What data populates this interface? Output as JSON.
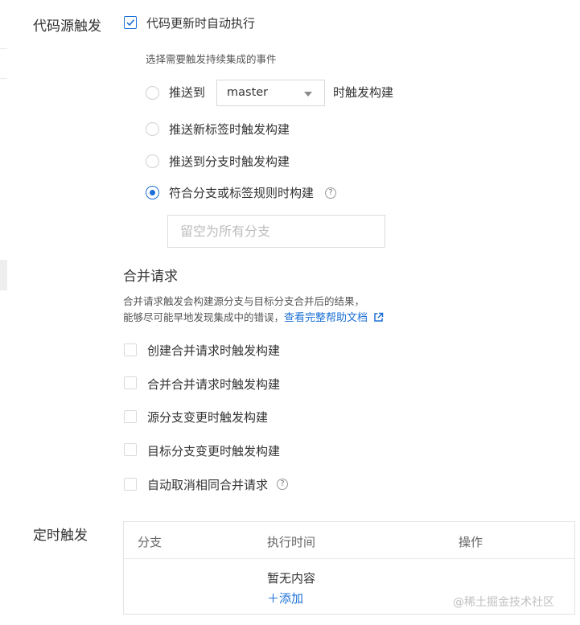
{
  "code_trigger": {
    "section_label": "代码源触发",
    "auto_run_label": "代码更新时自动执行",
    "auto_run_checked": true,
    "events_hint": "选择需要触发持续集成的事件",
    "push_to_label": "推送到",
    "branch_value": "master",
    "push_to_suffix": "时触发构建",
    "new_tag_label": "推送新标签时触发构建",
    "push_branch_label": "推送到分支时触发构建",
    "match_rule_label": "符合分支或标签规则时构建",
    "selected_option": "match_rule",
    "rule_placeholder": "留空为所有分支",
    "help_icon": "question-circle-icon",
    "checkbox_color": "#1b6fd6"
  },
  "merge_request": {
    "heading": "合并请求",
    "desc_line1": "合并请求触发会构建源分支与目标分支合并后的结果，",
    "desc_line2": "能够尽可能早地发现集成中的错误，",
    "help_link": "查看完整帮助文档",
    "link_icon": "external-link-icon",
    "options": [
      {
        "label": "创建合并请求时触发构建",
        "checked": false
      },
      {
        "label": "合并合并请求时触发构建",
        "checked": false
      },
      {
        "label": "源分支变更时触发构建",
        "checked": false
      },
      {
        "label": "目标分支变更时触发构建",
        "checked": false
      },
      {
        "label": "自动取消相同合并请求",
        "checked": false
      }
    ]
  },
  "scheduled": {
    "section_label": "定时触发",
    "columns": [
      "分支",
      "执行时间",
      "操作"
    ],
    "empty_text": "暂无内容",
    "add_label": "添加"
  },
  "watermark": "@稀土掘金技术社区"
}
